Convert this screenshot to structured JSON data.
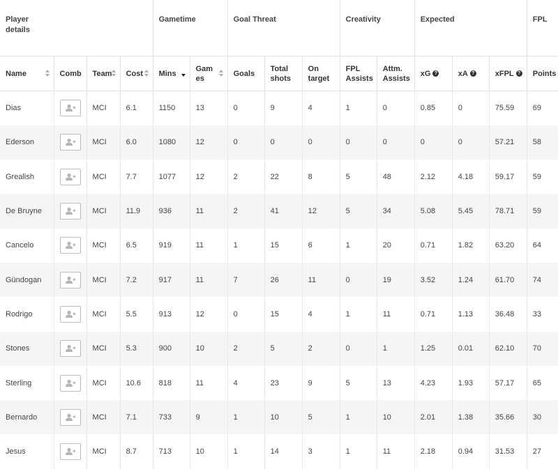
{
  "group_headers": [
    {
      "label": "Player details",
      "span": 4
    },
    {
      "label": "Gametime",
      "span": 2
    },
    {
      "label": "Goal Threat",
      "span": 3
    },
    {
      "label": "Creativity",
      "span": 2
    },
    {
      "label": "Expected",
      "span": 3
    },
    {
      "label": "FPL",
      "span": 1
    }
  ],
  "columns": [
    {
      "key": "name",
      "label": "Name",
      "sort": "both"
    },
    {
      "key": "comb",
      "label": "Comb",
      "sort": "none"
    },
    {
      "key": "team",
      "label": "Team",
      "sort": "both"
    },
    {
      "key": "cost",
      "label": "Cost",
      "sort": "both"
    },
    {
      "key": "mins",
      "label": "Mins",
      "sort": "desc"
    },
    {
      "key": "games",
      "label": "Games",
      "sort": "both"
    },
    {
      "key": "goals",
      "label": "Goals",
      "sort": "none"
    },
    {
      "key": "shots",
      "label": "Total shots",
      "sort": "none"
    },
    {
      "key": "ontarget",
      "label": "On target",
      "sort": "none"
    },
    {
      "key": "fplassists",
      "label": "FPL Assists",
      "sort": "none"
    },
    {
      "key": "attm",
      "label": "Attm. Assists",
      "sort": "none"
    },
    {
      "key": "xg",
      "label": "xG",
      "sort": "none",
      "info": true
    },
    {
      "key": "xa",
      "label": "xA",
      "sort": "none",
      "info": true
    },
    {
      "key": "xfpl",
      "label": "xFPL",
      "sort": "none",
      "info": true
    },
    {
      "key": "points",
      "label": "Points",
      "sort": "none"
    }
  ],
  "rows": [
    {
      "name": "Dias",
      "team": "MCI",
      "cost": "6.1",
      "mins": "1150",
      "games": "13",
      "goals": "0",
      "shots": "9",
      "ontarget": "4",
      "fplassists": "1",
      "attm": "0",
      "xg": "0.85",
      "xa": "0",
      "xfpl": "75.59",
      "points": "69"
    },
    {
      "name": "Ederson",
      "team": "MCI",
      "cost": "6.0",
      "mins": "1080",
      "games": "12",
      "goals": "0",
      "shots": "0",
      "ontarget": "0",
      "fplassists": "0",
      "attm": "0",
      "xg": "0",
      "xa": "0",
      "xfpl": "57.21",
      "points": "58"
    },
    {
      "name": "Grealish",
      "team": "MCI",
      "cost": "7.7",
      "mins": "1077",
      "games": "12",
      "goals": "2",
      "shots": "22",
      "ontarget": "8",
      "fplassists": "5",
      "attm": "48",
      "xg": "2.12",
      "xa": "4.18",
      "xfpl": "59.17",
      "points": "59"
    },
    {
      "name": "De Bruyne",
      "team": "MCI",
      "cost": "11.9",
      "mins": "936",
      "games": "11",
      "goals": "2",
      "shots": "41",
      "ontarget": "12",
      "fplassists": "5",
      "attm": "34",
      "xg": "5.08",
      "xa": "5.45",
      "xfpl": "78.71",
      "points": "59"
    },
    {
      "name": "Cancelo",
      "team": "MCI",
      "cost": "6.5",
      "mins": "919",
      "games": "11",
      "goals": "1",
      "shots": "15",
      "ontarget": "6",
      "fplassists": "1",
      "attm": "20",
      "xg": "0.71",
      "xa": "1.82",
      "xfpl": "63.20",
      "points": "64"
    },
    {
      "name": "Gündogan",
      "team": "MCI",
      "cost": "7.2",
      "mins": "917",
      "games": "11",
      "goals": "7",
      "shots": "26",
      "ontarget": "11",
      "fplassists": "0",
      "attm": "19",
      "xg": "3.52",
      "xa": "1.24",
      "xfpl": "61.70",
      "points": "74"
    },
    {
      "name": "Rodrigo",
      "team": "MCI",
      "cost": "5.5",
      "mins": "913",
      "games": "12",
      "goals": "0",
      "shots": "15",
      "ontarget": "4",
      "fplassists": "1",
      "attm": "11",
      "xg": "0.71",
      "xa": "1.13",
      "xfpl": "36.48",
      "points": "33"
    },
    {
      "name": "Stones",
      "team": "MCI",
      "cost": "5.3",
      "mins": "900",
      "games": "10",
      "goals": "2",
      "shots": "5",
      "ontarget": "2",
      "fplassists": "0",
      "attm": "1",
      "xg": "1.25",
      "xa": "0.01",
      "xfpl": "62.10",
      "points": "70"
    },
    {
      "name": "Sterling",
      "team": "MCI",
      "cost": "10.6",
      "mins": "818",
      "games": "11",
      "goals": "4",
      "shots": "23",
      "ontarget": "9",
      "fplassists": "5",
      "attm": "13",
      "xg": "4.23",
      "xa": "1.93",
      "xfpl": "57.17",
      "points": "65"
    },
    {
      "name": "Bernardo",
      "team": "MCI",
      "cost": "7.1",
      "mins": "733",
      "games": "9",
      "goals": "1",
      "shots": "10",
      "ontarget": "5",
      "fplassists": "1",
      "attm": "10",
      "xg": "2.01",
      "xa": "1.38",
      "xfpl": "35.66",
      "points": "30"
    },
    {
      "name": "Jesus",
      "team": "MCI",
      "cost": "8.7",
      "mins": "713",
      "games": "10",
      "goals": "1",
      "shots": "14",
      "ontarget": "3",
      "fplassists": "1",
      "attm": "11",
      "xg": "2.18",
      "xa": "0.94",
      "xfpl": "31.53",
      "points": "27"
    }
  ],
  "icons": {
    "comb_button": "add-user-icon",
    "info": "question-icon"
  }
}
